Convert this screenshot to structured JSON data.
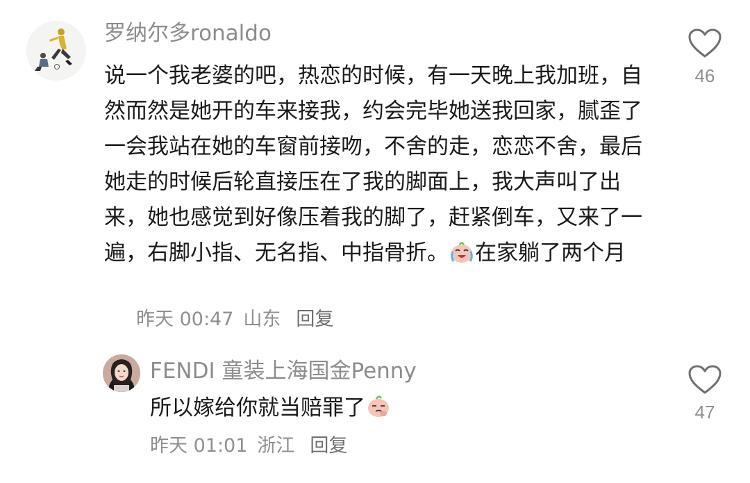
{
  "comments": [
    {
      "username": "罗纳尔多ronaldo",
      "text_before_emoji": "说一个我老婆的吧，热恋的时候，有一天晚上我加班，自然而然是她开的车来接我，约会完毕她送我回家，腻歪了一会我站在她的车窗前接吻，不舍的走，恋恋不舍，最后她走的时候后轮直接压在了我的脚面上，我大声叫了出来，她也感觉到好像压着我的脚了，赶紧倒车，又来了一遍，右脚小指、无名指、中指骨折。",
      "text_after_emoji": "在家躺了两个月",
      "emoji": "crying-laughing-emoji",
      "time": "昨天 00:47",
      "location": "山东",
      "reply_label": "回复",
      "likes": "46",
      "avatar": "soccer-player-avatar"
    },
    {
      "username": "FENDI 童装上海国金Penny",
      "text_before_emoji": "所以嫁给你就当赔罪了",
      "emoji": "smirk-peach-emoji",
      "time": "昨天 01:01",
      "location": "浙江",
      "reply_label": "回复",
      "likes": "47",
      "avatar": "woman-avatar"
    }
  ]
}
